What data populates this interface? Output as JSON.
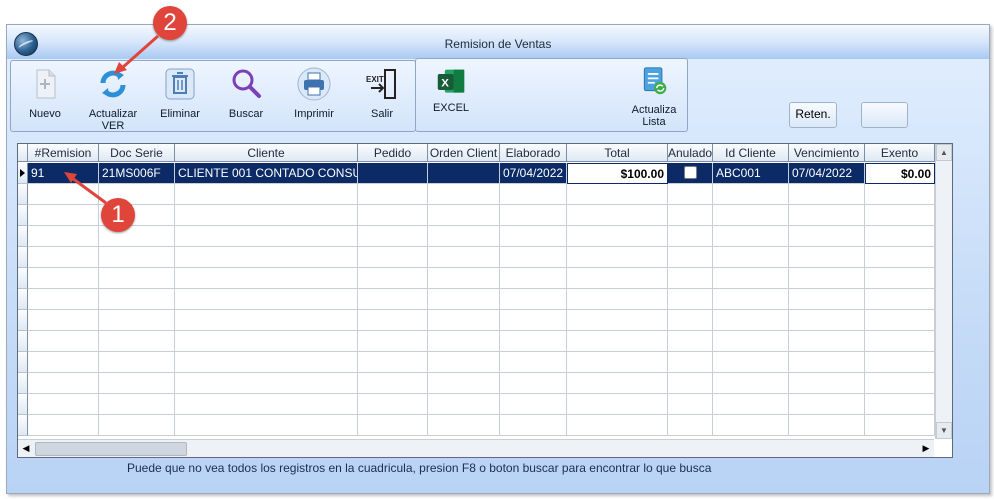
{
  "window": {
    "title": "Remision de Ventas"
  },
  "toolbar": {
    "buttons": [
      {
        "label": "Nuevo",
        "icon": "new-document-icon"
      },
      {
        "label": "Actualizar VER",
        "icon": "refresh-icon"
      },
      {
        "label": "Eliminar",
        "icon": "trash-icon"
      },
      {
        "label": "Buscar",
        "icon": "search-icon"
      },
      {
        "label": "Imprimir",
        "icon": "printer-icon"
      },
      {
        "label": "Salir",
        "icon": "exit-icon"
      }
    ],
    "excel_label": "EXCEL",
    "actualiza_lista_label": "Actualiza Lista"
  },
  "reten_label": "Reten.",
  "grid": {
    "columns": [
      "#Remision",
      "Doc Serie",
      "Cliente",
      "Pedido",
      "Orden Client",
      "Elaborado",
      "Total",
      "Anulado",
      "Id Cliente",
      "Vencimiento",
      "Exento"
    ],
    "rows": [
      {
        "remision": "91",
        "doc_serie": "21MS006F",
        "cliente": "CLIENTE 001 CONTADO CONSU",
        "pedido": "",
        "orden_cliente": "",
        "elaborado": "07/04/2022",
        "total": "$100.00",
        "anulado": false,
        "id_cliente": "ABC001",
        "vencimiento": "07/04/2022",
        "exento": "$0.00"
      }
    ]
  },
  "footer_note": "Puede que no vea todos los registros en la cuadricula, presion F8 o boton buscar para encontrar lo que busca",
  "annotations": [
    "1",
    "2"
  ],
  "colors": {
    "selected_row": "#0b2a66",
    "window_bg": "#c6dcf7",
    "badge": "#e0453b"
  }
}
